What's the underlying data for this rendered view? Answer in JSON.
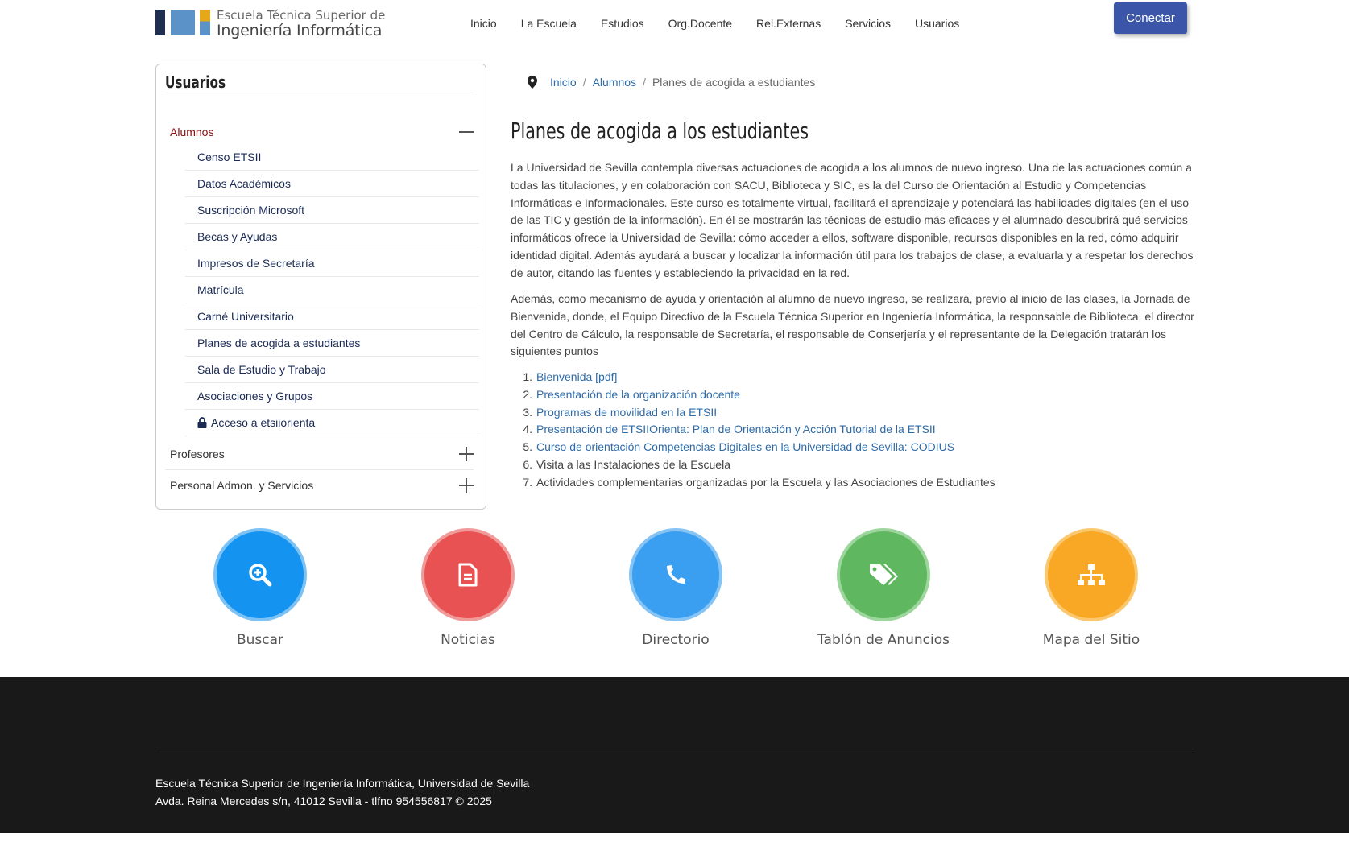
{
  "header": {
    "logo_line1": "Escuela Técnica Superior de",
    "logo_line2": "Ingeniería Informática",
    "nav": [
      "Inicio",
      "La Escuela",
      "Estudios",
      "Org.Docente",
      "Rel.Externas",
      "Servicios",
      "Usuarios"
    ],
    "connect_label": "Conectar",
    "colors": {
      "accent": "#3b56a8",
      "logo_dark": "#1f2f52",
      "logo_blue": "#5b93c9",
      "logo_gold": "#e6a817"
    }
  },
  "sidebar": {
    "title": "Usuarios",
    "sections": [
      {
        "label": "Alumnos",
        "expanded": true
      },
      {
        "label": "Profesores",
        "expanded": false
      },
      {
        "label": "Personal Admon. y Servicios",
        "expanded": false
      }
    ],
    "alumnos_items": [
      "Censo ETSII",
      "Datos Académicos",
      "Suscripción Microsoft",
      "Becas y Ayudas",
      "Impresos de Secretaría",
      "Matrícula",
      "Carné Universitario",
      "Planes de acogida a estudiantes",
      "Sala de Estudio y Trabajo",
      "Asociaciones y Grupos",
      "Acceso a etsiiorienta"
    ]
  },
  "breadcrumb": {
    "items": [
      "Inicio",
      "Alumnos"
    ],
    "current": "Planes de acogida a estudiantes"
  },
  "content": {
    "title": "Planes de acogida a los estudiantes",
    "paragraph1": "La Universidad de Sevilla contempla diversas actuaciones de acogida a los alumnos de nuevo ingreso. Una de las actuaciones común a todas las titulaciones, y en colaboración con SACU, Biblioteca y SIC, es la del Curso de Orientación al Estudio y Competencias Informáticas e Informacionales. Este curso es totalmente virtual, facilitará el aprendizaje y potenciará las habilidades digitales (en el uso de las TIC y gestión de la información). En él se mostrarán las técnicas de estudio más eficaces y el alumnado descubrirá qué servicios informáticos ofrece la Universidad de Sevilla: cómo acceder a ellos, software disponible, recursos disponibles en la red, cómo adquirir identidad digital. Además ayudará a buscar y localizar la información útil para los trabajos de clase, a evaluarla y a respetar los derechos de autor, citando las fuentes y estableciendo la privacidad en la red.",
    "paragraph2": "Además, como mecanismo de ayuda y orientación al alumno de nuevo ingreso, se realizará, previo al inicio de las clases, la Jornada de Bienvenida, donde, el Equipo Directivo de la Escuela Técnica Superior en Ingeniería Informática, la responsable de Biblioteca, el director del Centro de Cálculo, la responsable de Secretaría, el responsable de Conserjería y el representante de la Delegación tratarán los siguientes puntos",
    "list": [
      {
        "num": "1.",
        "text": "Bienvenida [pdf]",
        "link": true
      },
      {
        "num": "2.",
        "text": "Presentación de la organización docente",
        "link": true
      },
      {
        "num": "3.",
        "text": "Programas de movilidad en la ETSII",
        "link": true
      },
      {
        "num": "4.",
        "text": "Presentación de ETSIIOrienta: Plan de Orientación y Acción Tutorial de la ETSII",
        "link": true
      },
      {
        "num": "5.",
        "text": "Curso de orientación Competencias Digitales en la Universidad de Sevilla: CODIUS",
        "link": true
      },
      {
        "num": "6.",
        "text": "Visita a las Instalaciones de la Escuela",
        "link": false
      },
      {
        "num": "7.",
        "text": "Actividades complementarias organizadas por la Escuela y las Asociaciones de Estudiantes",
        "link": false
      }
    ]
  },
  "quick_links": [
    {
      "label": "Buscar",
      "icon": "search-plus-icon",
      "color": "#1493f0",
      "ring": "#7cc2f5"
    },
    {
      "label": "Noticias",
      "icon": "document-icon",
      "color": "#e85252",
      "ring": "#f09a9a"
    },
    {
      "label": "Directorio",
      "icon": "phone-icon",
      "color": "#3a9ff0",
      "ring": "#85c4f5"
    },
    {
      "label": "Tablón de Anuncios",
      "icon": "tags-icon",
      "color": "#5fb85f",
      "ring": "#9dd69d"
    },
    {
      "label": "Mapa del Sitio",
      "icon": "sitemap-icon",
      "color": "#f9a825",
      "ring": "#fbc870"
    }
  ],
  "footer": {
    "line1": "Escuela Técnica Superior de Ingeniería Informática, Universidad de Sevilla",
    "line2": "Avda. Reina Mercedes s/n, 41012 Sevilla - tlfno 954556817 © 2025"
  }
}
